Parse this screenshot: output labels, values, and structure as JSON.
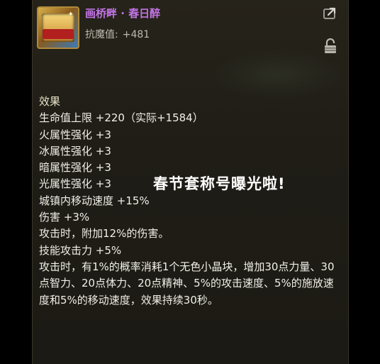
{
  "item": {
    "name": "画桥畔 · 春日醉",
    "resist_label": "抗魔值:",
    "resist_value": "+481",
    "icon": "title-badge-icon"
  },
  "header_icons": {
    "share": "share-icon",
    "lock": "lock-icon"
  },
  "effects": {
    "title": "效果",
    "lines": [
      "生命值上限 +220（实际+1584）",
      "火属性强化 +3",
      "冰属性强化 +3",
      "暗属性强化 +3",
      "光属性强化 +3",
      "城镇内移动速度 +15%",
      "伤害 +3%",
      "攻击时，附加12%的伤害。",
      "技能攻击力 +5%"
    ],
    "proc_text": "攻击时，有1%的概率消耗1个无色小晶块，增加30点力量、30点智力、20点体力、20点精神、5%的攻击速度、5%的施放速度和5%的移动速度，效果持续30秒。"
  },
  "overlay": {
    "caption": "春节套称号曝光啦!"
  },
  "colors": {
    "name": "#c274e6",
    "text": "#f1efe8",
    "subtext": "#bdbab0",
    "panel": "#1f1d16"
  }
}
